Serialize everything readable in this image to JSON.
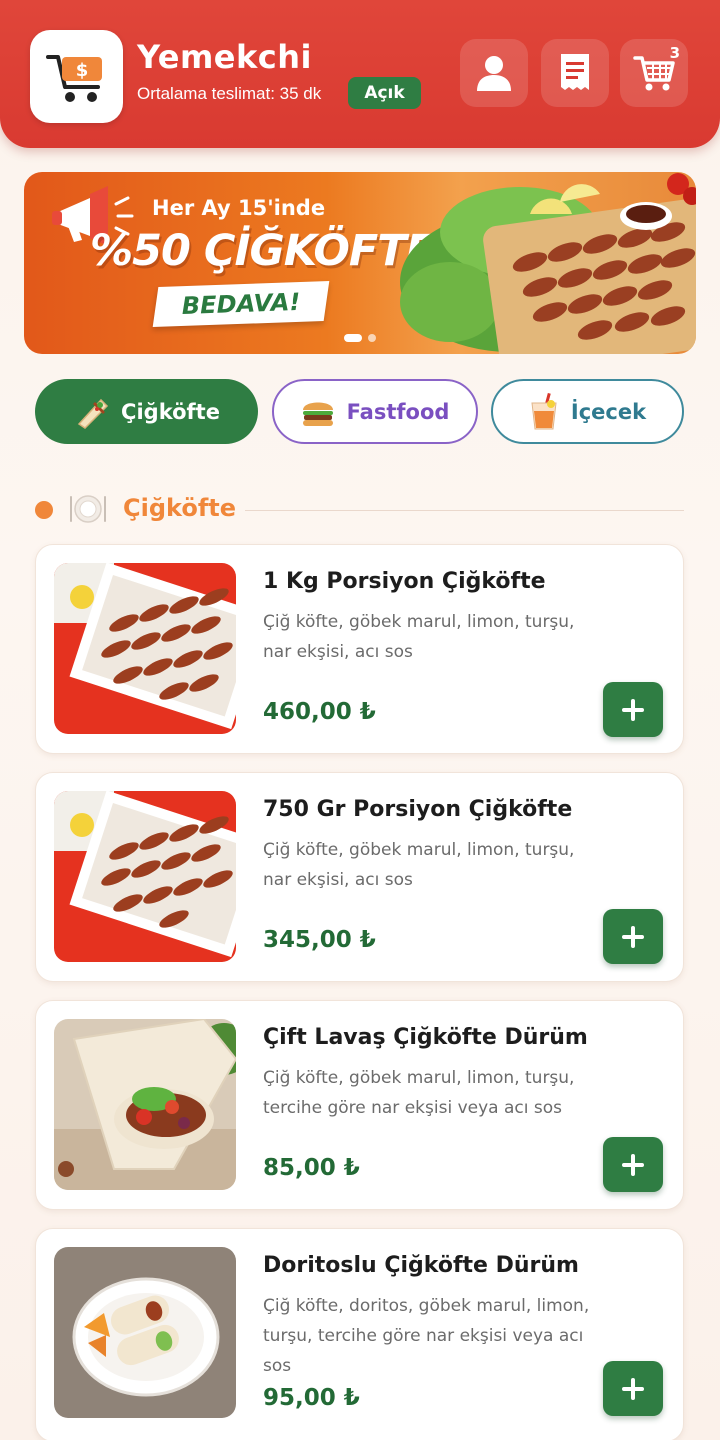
{
  "header": {
    "app_title": "Yemekchi",
    "delivery_text": "Ortalama teslimat: 35 dk",
    "status_badge": "Açık",
    "cart_count": "3",
    "icons": [
      "cart-dollar-icon",
      "user-icon",
      "receipt-icon",
      "cart-icon"
    ]
  },
  "banner": {
    "subtitle": "Her Ay 15'inde",
    "title": "%50 ÇİĞKÖFTE",
    "ribbon": "BEDAVA!",
    "slides_total": 2,
    "active_slide": 1
  },
  "tabs": [
    {
      "label": "Çiğköfte",
      "icon": "wrap-icon",
      "active": true
    },
    {
      "label": "Fastfood",
      "icon": "burger-icon",
      "active": false
    },
    {
      "label": "İçecek",
      "icon": "drink-icon",
      "active": false
    }
  ],
  "section": {
    "title": "Çiğköfte",
    "icon": "plate-icon"
  },
  "products": [
    {
      "name": "1 Kg Porsiyon Çiğköfte",
      "description": "Çiğ köfte, göbek marul, limon, turşu, nar ekşisi, acı sos",
      "price": "460,00 ₺"
    },
    {
      "name": "750 Gr Porsiyon Çiğköfte",
      "description": "Çiğ köfte, göbek marul, limon, turşu, nar ekşisi, acı sos",
      "price": "345,00 ₺"
    },
    {
      "name": "Çift Lavaş Çiğköfte Dürüm",
      "description": "Çiğ köfte, göbek marul, limon, turşu, tercihe göre nar ekşisi veya acı sos",
      "price": "85,00 ₺"
    },
    {
      "name": "Doritoslu Çiğköfte Dürüm",
      "description": "Çiğ köfte, doritos, göbek marul, limon, turşu, tercihe göre nar ekşisi veya acı sos",
      "price": "95,00 ₺"
    }
  ],
  "colors": {
    "header": "#d93a31",
    "brand_green": "#2f7d43",
    "accent_orange": "#f0873a",
    "fastfood_purple": "#7a4fc0",
    "drink_teal": "#2f7a8f"
  }
}
